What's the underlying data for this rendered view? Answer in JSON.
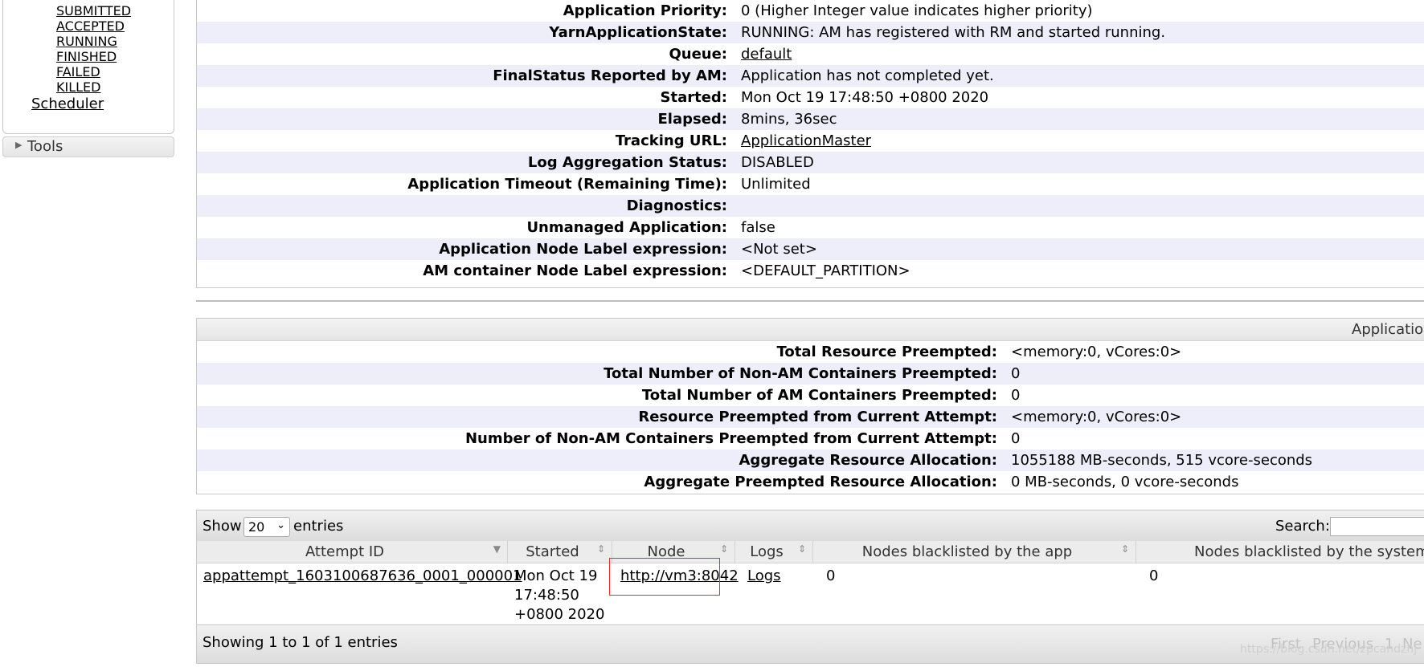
{
  "nav": {
    "states": [
      "SUBMITTED",
      "ACCEPTED",
      "RUNNING",
      "FINISHED",
      "FAILED",
      "KILLED"
    ],
    "scheduler": "Scheduler",
    "tools": "Tools"
  },
  "overview": {
    "rows": [
      {
        "key": "Application Priority:",
        "value": "0 (Higher Integer value indicates higher priority)"
      },
      {
        "key": "YarnApplicationState:",
        "value": "RUNNING: AM has registered with RM and started running."
      },
      {
        "key": "Queue:",
        "value": "default"
      },
      {
        "key": "FinalStatus Reported by AM:",
        "value": "Application has not completed yet."
      },
      {
        "key": "Started:",
        "value": "Mon Oct 19 17:48:50 +0800 2020"
      },
      {
        "key": "Elapsed:",
        "value": "8mins, 36sec"
      },
      {
        "key": "Tracking URL:",
        "value": "ApplicationMaster"
      },
      {
        "key": "Log Aggregation Status:",
        "value": "DISABLED"
      },
      {
        "key": "Application Timeout (Remaining Time):",
        "value": "Unlimited"
      },
      {
        "key": "Diagnostics:",
        "value": ""
      },
      {
        "key": "Unmanaged Application:",
        "value": "false"
      },
      {
        "key": "Application Node Label expression:",
        "value": "<Not set>"
      },
      {
        "key": "AM container Node Label expression:",
        "value": "<DEFAULT_PARTITION>"
      }
    ]
  },
  "metrics": {
    "header": "Applicatio",
    "rows": [
      {
        "key": "Total Resource Preempted:",
        "value": "<memory:0, vCores:0>"
      },
      {
        "key": "Total Number of Non-AM Containers Preempted:",
        "value": "0"
      },
      {
        "key": "Total Number of AM Containers Preempted:",
        "value": "0"
      },
      {
        "key": "Resource Preempted from Current Attempt:",
        "value": "<memory:0, vCores:0>"
      },
      {
        "key": "Number of Non-AM Containers Preempted from Current Attempt:",
        "value": "0"
      },
      {
        "key": "Aggregate Resource Allocation:",
        "value": "1055188 MB-seconds, 515 vcore-seconds"
      },
      {
        "key": "Aggregate Preempted Resource Allocation:",
        "value": "0 MB-seconds, 0 vcore-seconds"
      }
    ]
  },
  "attempts": {
    "show_label": "Show",
    "page_size": "20",
    "entries_label": "entries",
    "search_label": "Search:",
    "columns": [
      "Attempt ID",
      "Started",
      "Node",
      "Logs",
      "Nodes blacklisted by the app",
      "Nodes blacklisted by the system"
    ],
    "rows": [
      {
        "attempt_id": "appattempt_1603100687636_0001_000001",
        "started_line1": "Mon Oct 19",
        "started_line2": "17:48:50",
        "started_line3": "+0800 2020",
        "node": "http://vm3:8042",
        "logs": "Logs",
        "blacklisted_app": "0",
        "blacklisted_system": "0"
      }
    ],
    "info": "Showing 1 to 1 of 1 entries",
    "pager": {
      "first": "First",
      "previous": "Previous",
      "page": "1",
      "next": "Ne"
    }
  },
  "watermark": "https://blog.csdn.net/zpcandzhj"
}
